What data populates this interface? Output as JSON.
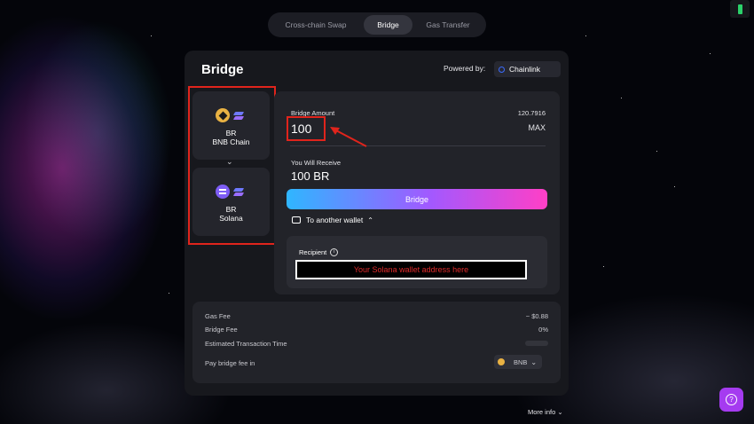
{
  "nav": {
    "tabs": [
      {
        "label": "Cross-chain Swap",
        "active": false
      },
      {
        "label": "Bridge",
        "active": true
      },
      {
        "label": "Gas Transfer",
        "active": false
      }
    ]
  },
  "panel": {
    "title": "Bridge",
    "powered_by": "Powered by:",
    "provider": "Chainlink"
  },
  "from_chain": {
    "token": "BR",
    "network": "BNB Chain",
    "icon": "bnb-chain-icon"
  },
  "to_chain": {
    "token": "BR",
    "network": "Solana",
    "icon": "solana-icon"
  },
  "form": {
    "amount_label": "Bridge Amount",
    "balance": "120.7916",
    "amount_value": "100",
    "max_label": "MAX",
    "receive_label": "You Will Receive",
    "receive_value": "100 BR",
    "bridge_button": "Bridge",
    "another_wallet": "To another wallet",
    "recipient_label": "Recipient",
    "recipient_placeholder": "Your Solana wallet address here"
  },
  "fees": {
    "gas_fee_label": "Gas Fee",
    "gas_fee_value": "~ $0.88",
    "bridge_fee_label": "Bridge Fee",
    "bridge_fee_value": "0%",
    "time_label": "Estimated Transaction Time",
    "pay_label": "Pay bridge fee in",
    "pay_token": "BNB"
  },
  "footer": {
    "more_info": "More info"
  },
  "colors": {
    "accent_start": "#2fb6ff",
    "accent_mid": "#a259ff",
    "accent_end": "#ff3fc6",
    "annotation_red": "#e0241c"
  }
}
